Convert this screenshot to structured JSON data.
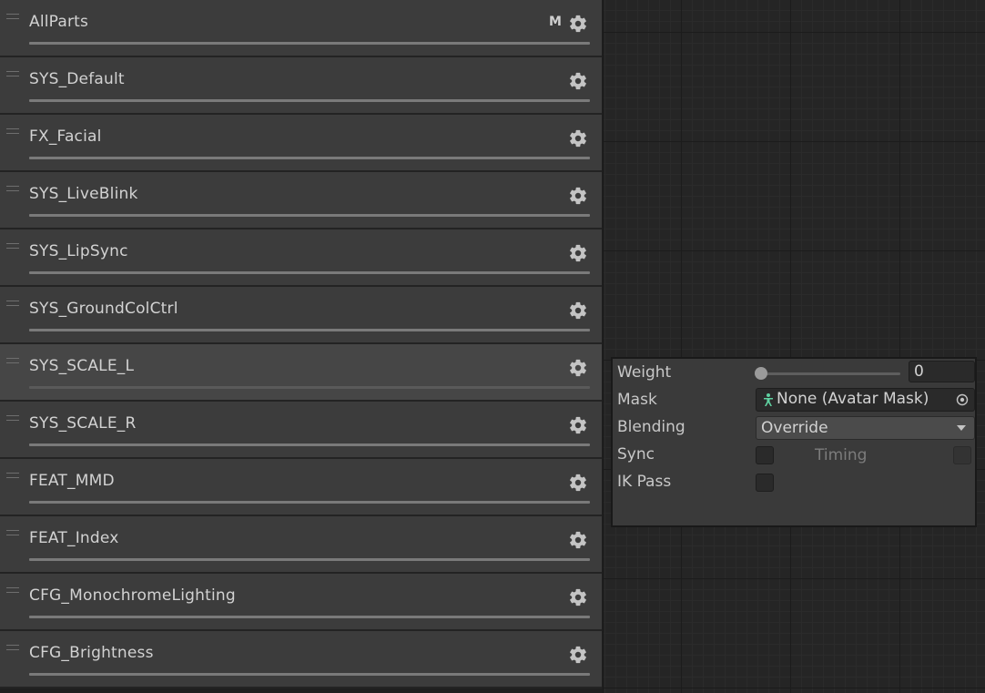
{
  "layers": [
    {
      "name": "AllParts",
      "badge": "M"
    },
    {
      "name": "SYS_Default"
    },
    {
      "name": "FX_Facial"
    },
    {
      "name": "SYS_LiveBlink"
    },
    {
      "name": "SYS_LipSync"
    },
    {
      "name": "SYS_GroundColCtrl"
    },
    {
      "name": "SYS_SCALE_L",
      "selected": true
    },
    {
      "name": "SYS_SCALE_R"
    },
    {
      "name": "FEAT_MMD"
    },
    {
      "name": "FEAT_Index"
    },
    {
      "name": "CFG_MonochromeLighting"
    },
    {
      "name": "CFG_Brightness"
    }
  ],
  "layer_settings": {
    "weight_label": "Weight",
    "weight_value": "0",
    "weight_fraction": 0,
    "mask_label": "Mask",
    "mask_value": "None (Avatar Mask)",
    "blending_label": "Blending",
    "blending_value": "Override",
    "sync_label": "Sync",
    "sync_checked": false,
    "timing_label": "Timing",
    "timing_checked": false,
    "ik_pass_label": "IK Pass",
    "ik_pass_checked": false
  },
  "icons": {
    "layer_settings": "gear-icon",
    "drag": "drag-handle-icon",
    "mask_type": "avatar-mask-icon",
    "object_picker": "object-picker-icon"
  },
  "colors": {
    "exit_node": "#a51c1c",
    "entry_node": "#27883a"
  }
}
